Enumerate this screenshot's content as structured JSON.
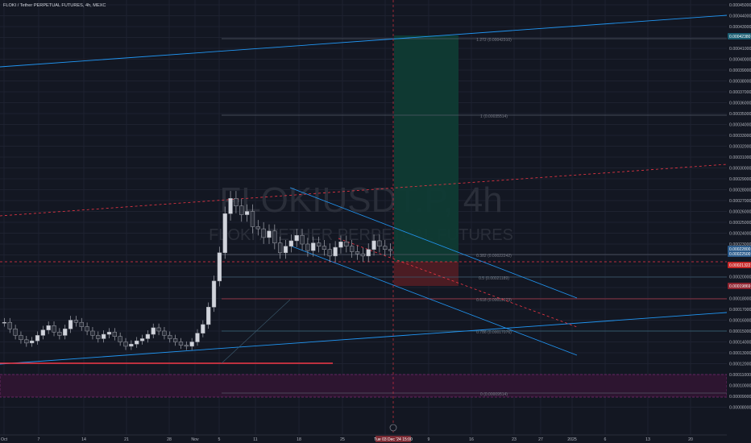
{
  "header": {
    "symbol_line": "FLOKI / Tether PERPETUAL FUTURES, 4h, MEXC"
  },
  "watermark": {
    "ticker": "FLOKIUSDT.P, 4h",
    "name": "FLOKI / TETHER PERPETUAL FUTURES"
  },
  "colors": {
    "background": "#131722",
    "grid": "#1e2230",
    "up": "#d1d4dc",
    "down": "#2a2e39",
    "channel": "#2196f3",
    "trend": "#f23645",
    "profit": "#0f3b34",
    "loss": "#4e1c24",
    "zone": "#2d1530",
    "axis_text": "#b2b5be"
  },
  "chart_data": {
    "type": "candlestick",
    "title": "FLOKI / Tether PERPETUAL FUTURES, 4h, MEXC",
    "x_axis": {
      "type": "date",
      "tick_labels": [
        "Oct",
        "7",
        "14",
        "21",
        "28",
        "Nov",
        "5",
        "11",
        "18",
        "25",
        "Dec",
        "9",
        "16",
        "23",
        "27",
        "2025",
        "6",
        "13",
        "20"
      ],
      "crosshair_label": "Tue 03 Dec '24  15:00"
    },
    "y_axis": {
      "scale": "linear",
      "range": [
        8e-05,
        0.000455
      ],
      "tick_labels": [
        "0.00045000",
        "0.00044000",
        "0.00043000",
        "0.00042000",
        "0.00041000",
        "0.00040000",
        "0.00039000",
        "0.00038000",
        "0.00037000",
        "0.00036000",
        "0.00035000",
        "0.00034000",
        "0.00033000",
        "0.00032000",
        "0.00031000",
        "0.00030000",
        "0.00029000",
        "0.00028000",
        "0.00027000",
        "0.00026000",
        "0.00025000",
        "0.00024000",
        "0.00023000",
        "0.00022000",
        "0.00021000",
        "0.00020000",
        "0.00019000",
        "0.00018000",
        "0.00017000",
        "0.00016000",
        "0.00015000",
        "0.00014000",
        "0.00013000",
        "0.00012000",
        "0.00011000",
        "0.00010000",
        "0.00009000",
        "0.00008000"
      ],
      "price_tags": [
        {
          "label": "0.00042380",
          "kind": "target"
        },
        {
          "label": "0.00022800",
          "kind": "price"
        },
        {
          "label": "0.00022500",
          "kind": "price"
        },
        {
          "label": "0.00021322",
          "kind": "current"
        },
        {
          "label": "0.00019869",
          "kind": "stop"
        }
      ],
      "grid": true
    },
    "fibonacci_levels": [
      {
        "ratio": "1.272",
        "label": "1.272 (0.00042310)"
      },
      {
        "ratio": "1",
        "label": "1 (0.00035514)"
      },
      {
        "ratio": "0.382",
        "label": "0.382 (0.00022242)"
      },
      {
        "ratio": "0.5",
        "label": "0.5 (0.00021189)"
      },
      {
        "ratio": "0.618",
        "label": "0.618 (0.00019123)"
      },
      {
        "ratio": "0.786",
        "label": "0.786 (0.00017076)"
      },
      {
        "ratio": "0",
        "label": "0 (0.00009514)"
      }
    ],
    "close_series": {
      "values": [
        0.000158,
        0.000152,
        0.000146,
        0.000142,
        0.000139,
        0.000141,
        0.000146,
        0.000151,
        0.000155,
        0.000149,
        0.000146,
        0.000152,
        0.00016,
        0.000158,
        0.000154,
        0.00015,
        0.000146,
        0.000143,
        0.000147,
        0.000149,
        0.000145,
        0.00014,
        0.000136,
        0.000138,
        0.000141,
        0.000143,
        0.000147,
        0.000153,
        0.00015,
        0.000146,
        0.000143,
        0.00014,
        0.000137,
        0.000136,
        0.00014,
        0.000148,
        0.000156,
        0.000172,
        0.000196,
        0.000222,
        0.000258,
        0.000272,
        0.000265,
        0.000257,
        0.00026,
        0.000246,
        0.000244,
        0.000236,
        0.000242,
        0.000231,
        0.000222,
        0.000228,
        0.000233,
        0.000238,
        0.00023,
        0.000224,
        0.000231,
        0.000228,
        0.000225,
        0.000219,
        0.000227,
        0.000232,
        0.000228,
        0.000223,
        0.000221,
        0.000219,
        0.000225,
        0.000233,
        0.000228,
        0.000225,
        0.000224
      ]
    }
  }
}
